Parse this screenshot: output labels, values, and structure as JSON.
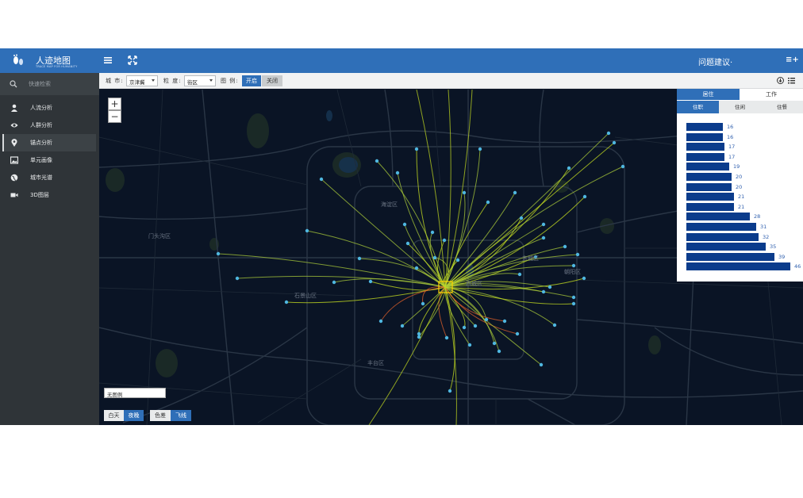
{
  "header": {
    "brand": "人迹地图",
    "brand_sub": "TRACE MAP FOR HUMANITY",
    "feedback": "问题建议·",
    "user_menu": "≡+"
  },
  "sidebar": {
    "search_label": "快速检索",
    "items": [
      {
        "label": "人流分析",
        "icon": "person-icon"
      },
      {
        "label": "人群分析",
        "icon": "eye-icon"
      },
      {
        "label": "锚点分析",
        "icon": "map-pin-icon",
        "active": true
      },
      {
        "label": "单元画像",
        "icon": "image-icon"
      },
      {
        "label": "城市光谱",
        "icon": "globe-icon"
      },
      {
        "label": "3D图层",
        "icon": "video-icon"
      }
    ]
  },
  "toolbar": {
    "city_label": "城 市:",
    "city_value": "京津冀",
    "granularity_label": "粒 度:",
    "granularity_value": "街区",
    "legend_label": "图 例:",
    "on_label": "开启",
    "off_label": "关闭"
  },
  "map": {
    "zoom_in": "+",
    "zoom_out": "−",
    "districts": [
      "门头沟区",
      "海淀区",
      "石景山区",
      "丰台区",
      "朝阳区",
      "东城区",
      "西城区"
    ],
    "legend_box": "无图例",
    "day_label": "白天",
    "night_label": "夜晚",
    "color_label": "色差",
    "fly_label": "飞线"
  },
  "panel": {
    "tab_live": "居住",
    "tab_work": "工作",
    "sub_tabs": [
      "住职",
      "住闲",
      "住餐"
    ],
    "bar_values": [
      16,
      16,
      17,
      17,
      19,
      20,
      20,
      21,
      21,
      28,
      31,
      32,
      35,
      39,
      46
    ],
    "bar_max": 46,
    "bar_color": "#0b3c8c"
  }
}
